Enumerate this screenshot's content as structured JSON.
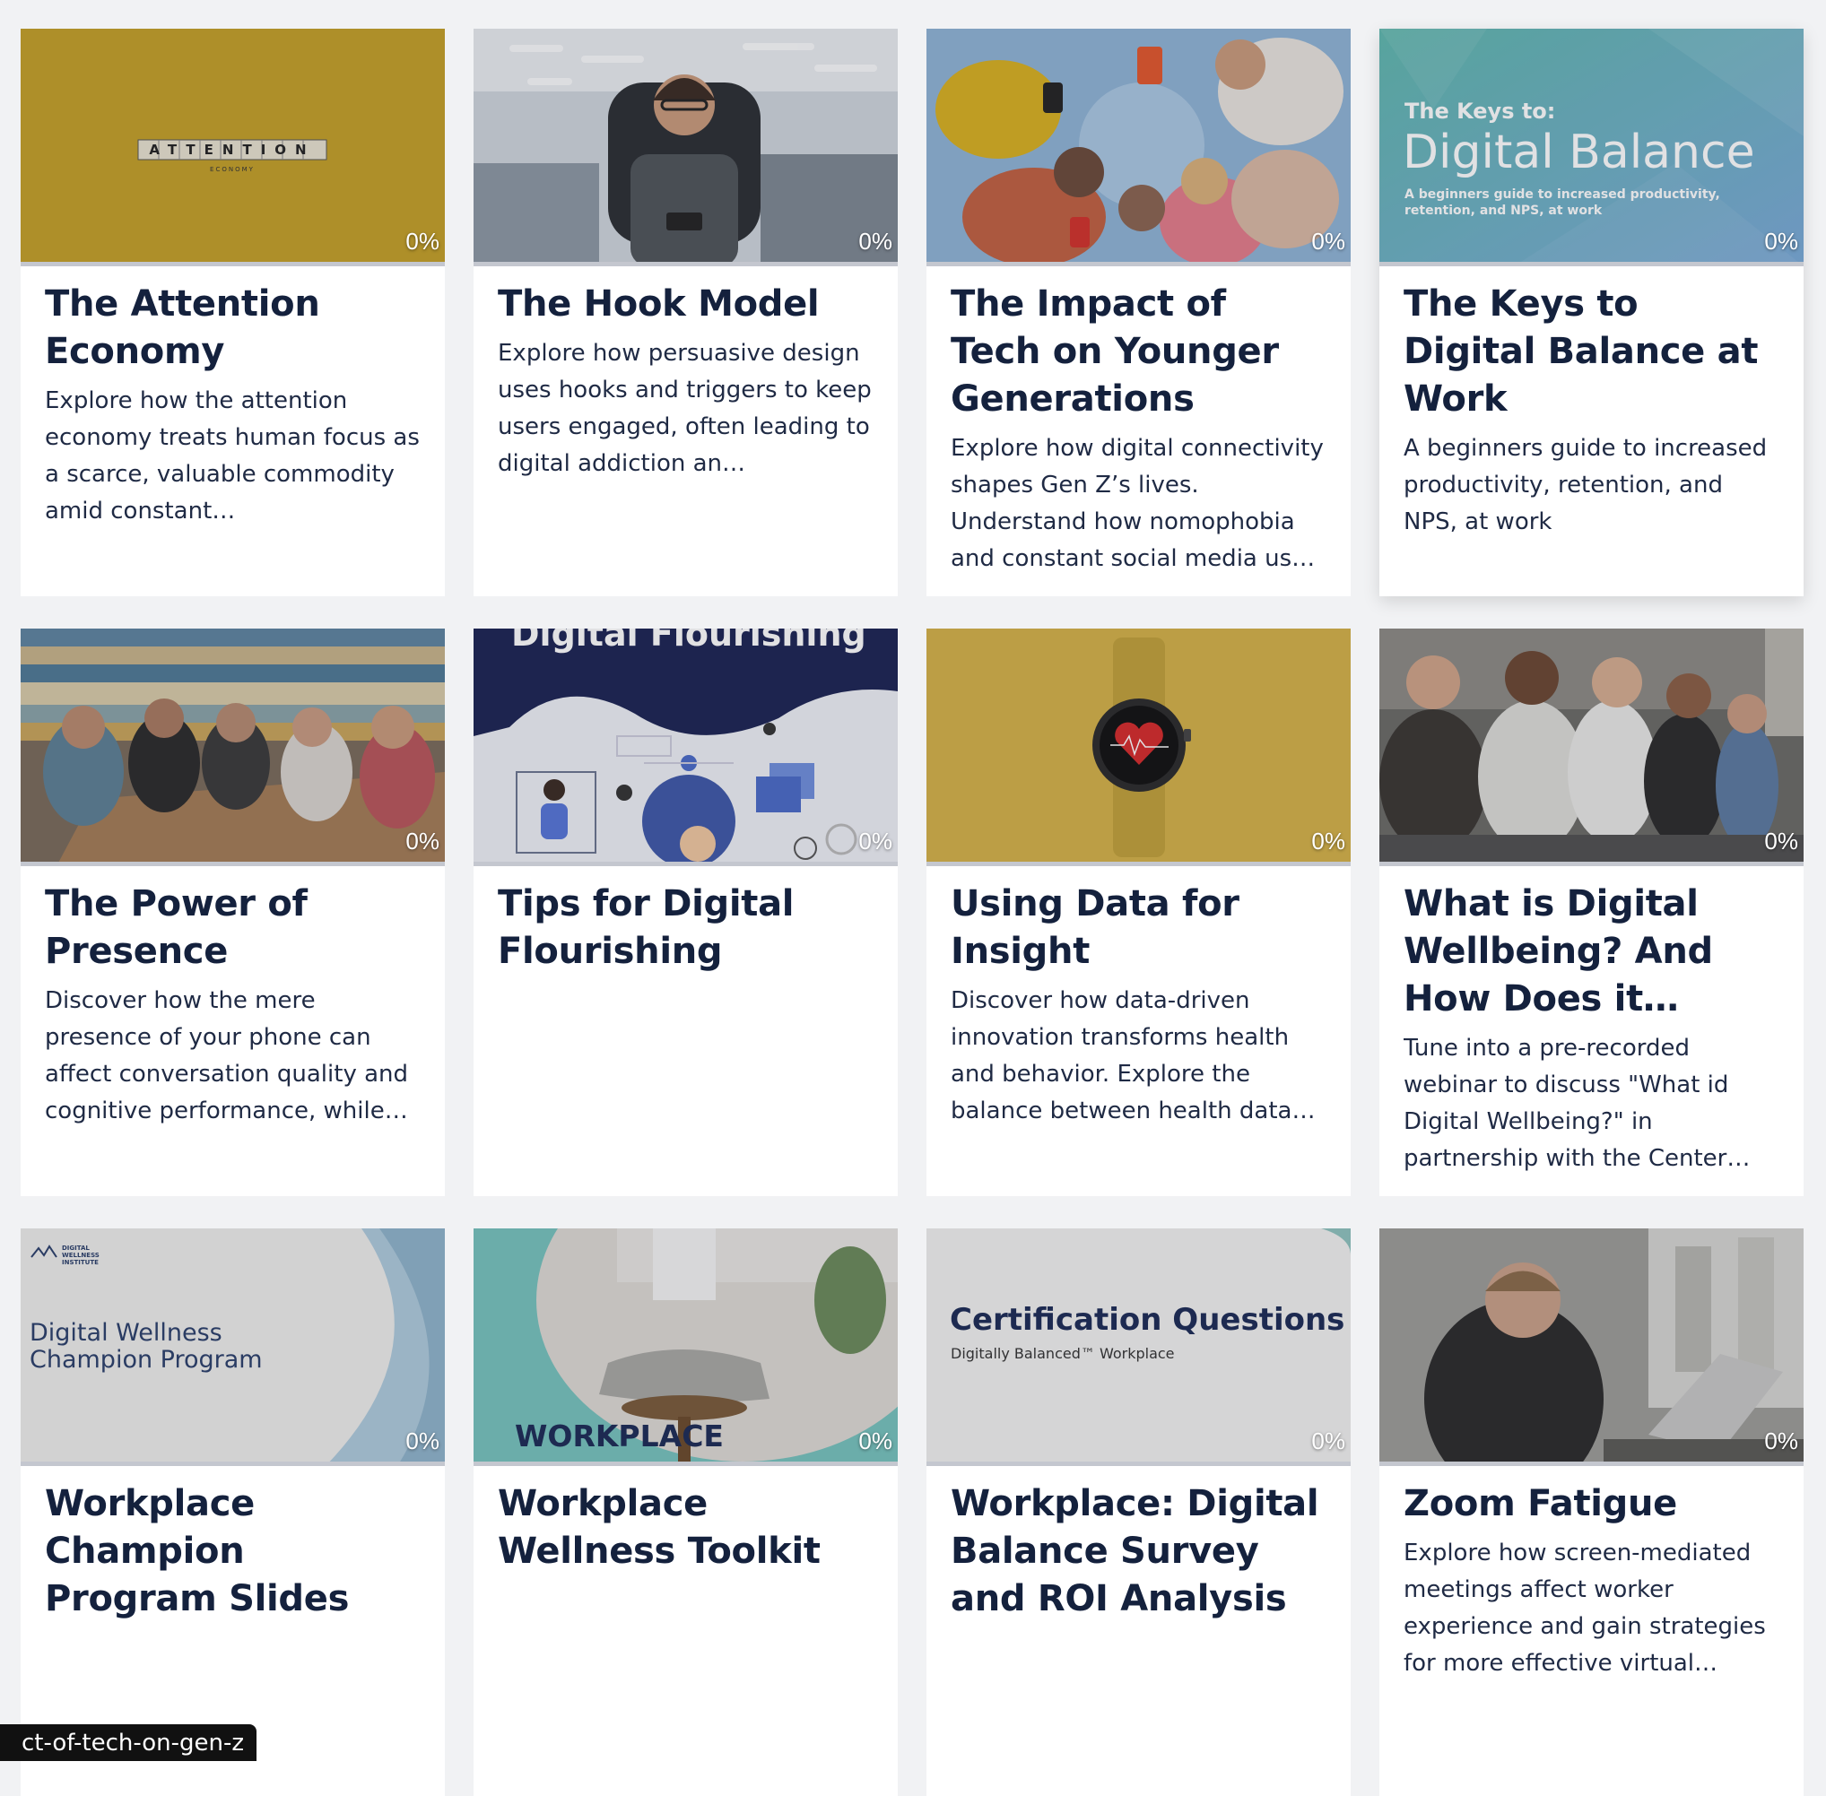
{
  "cards": [
    {
      "title": "The Attention Economy",
      "description": "Explore how the attention economy treats human focus as a scarce, valuable commodity amid constant…",
      "progress_label": "0%",
      "image": "attention-economy-thumbnail",
      "thumb_text": {
        "main": "ATTENTION",
        "sub": "ECONOMY"
      }
    },
    {
      "title": "The Hook Model",
      "description": "Explore how persuasive design uses hooks and triggers to keep users engaged, often leading to digital addiction an…",
      "progress_label": "0%",
      "image": "woman-with-headset-office-photo"
    },
    {
      "title": "The Impact of Tech on Younger Generations",
      "description": "Explore how digital connectivity shapes Gen Z’s lives. Understand how nomophobia and constant social media us…",
      "progress_label": "0%",
      "image": "young-people-with-phones-photo"
    },
    {
      "title": "The Keys to Digital Balance at Work",
      "description": "A beginners guide to increased productivity, retention, and NPS, at work",
      "progress_label": "0%",
      "image": "digital-balance-cover",
      "thumb_text": {
        "kicker": "The Keys to:",
        "main": "Digital Balance",
        "sub": "A beginners guide to increased productivity, retention, and NPS, at work"
      }
    },
    {
      "title": "The Power of Presence",
      "description": "Discover how the mere presence of your phone can affect conversation quality and cognitive performance, while…",
      "progress_label": "0%",
      "image": "friends-on-phones-at-table-photo"
    },
    {
      "title": "Tips for Digital Flourishing",
      "description": "",
      "progress_label": "0%",
      "image": "digital-flourishing-illustration",
      "thumb_text": {
        "main": "Digital Flourishing"
      }
    },
    {
      "title": "Using Data for Insight",
      "description": "Discover how data-driven innovation transforms health and behavior. Explore the balance between health data…",
      "progress_label": "0%",
      "image": "smartwatch-heart-photo"
    },
    {
      "title": "What is Digital Wellbeing? And How Does it…",
      "description": "Tune into a pre-recorded webinar to discuss \"What id Digital Wellbeing?\" in partnership with the Center fo…",
      "progress_label": "0%",
      "image": "group-of-young-men-photo"
    },
    {
      "title": "Workplace Champion Program Slides",
      "description": "",
      "progress_label": "0%",
      "image": "champion-program-slide",
      "thumb_text": {
        "logo": "DIGITAL WELLNESS INSTITUTE",
        "main": "Digital Wellness Champion Program"
      }
    },
    {
      "title": "Workplace Wellness Toolkit",
      "description": "",
      "progress_label": "0%",
      "image": "workplace-meditation-cover",
      "thumb_text": {
        "main": "WORKPLACE"
      }
    },
    {
      "title": "Workplace: Digital Balance Survey and ROI Analysis",
      "description": "",
      "progress_label": "0%",
      "image": "certification-questions-slide",
      "thumb_text": {
        "main": "Certification Questions",
        "sub": "Digitally Balanced™ Workplace"
      }
    },
    {
      "title": "Zoom Fatigue",
      "description": "Explore how screen-mediated meetings affect worker experience and gain strategies for more effective virtual…",
      "progress_label": "0%",
      "image": "tired-man-at-laptop-photo"
    }
  ],
  "status_url": "ct-of-tech-on-gen-z",
  "colors": {
    "page_background": "#f1f2f4",
    "card_background": "#ffffff",
    "title": "#14213d",
    "body_text": "#1f2a44"
  }
}
